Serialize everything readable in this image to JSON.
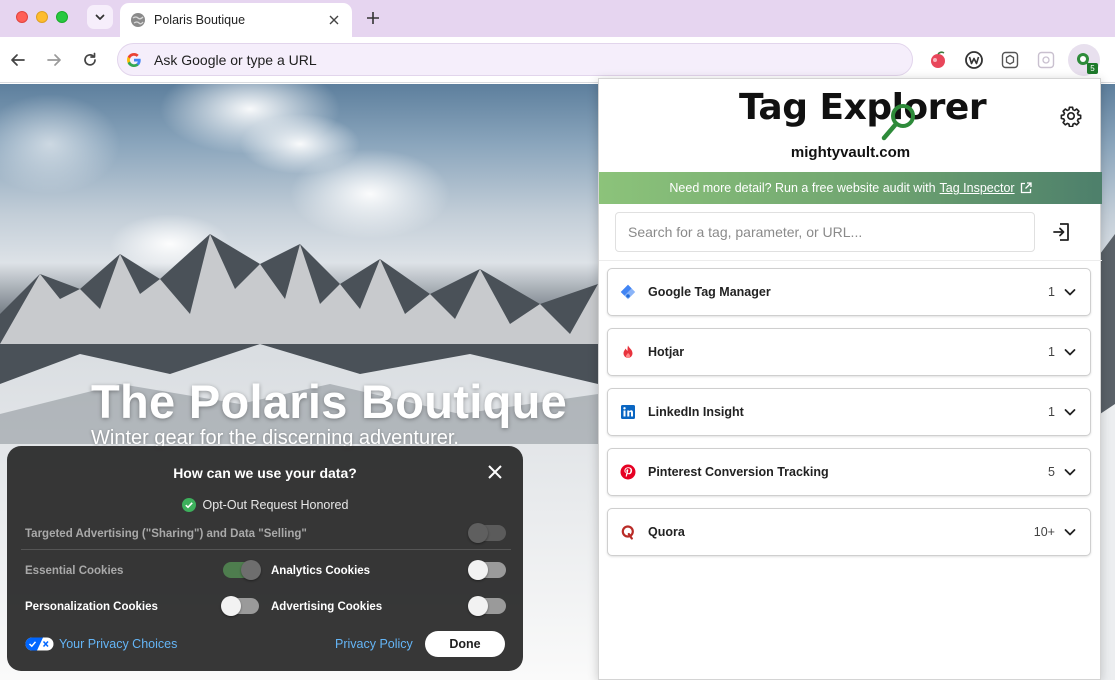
{
  "browser": {
    "tab_title": "Polaris Boutique",
    "omnibox_placeholder": "Ask Google or type a URL",
    "extension_badge": "5",
    "colors": {
      "tabstrip": "#e6d5f0",
      "omnibox": "#f5eefb"
    }
  },
  "page": {
    "hero_title": "The Polaris Boutique",
    "hero_subtitle": "Winter gear for the discerning adventurer."
  },
  "consent": {
    "title": "How can we use your data?",
    "status": "Opt-Out Request Honored",
    "rows": {
      "targeted": "Targeted Advertising (\"Sharing\") and Data \"Selling\"",
      "essential": "Essential Cookies",
      "analytics": "Analytics Cookies",
      "personalization": "Personalization Cookies",
      "advertising": "Advertising Cookies"
    },
    "privacy_choices": "Your Privacy Choices",
    "privacy_policy": "Privacy Policy",
    "done": "Done"
  },
  "popup": {
    "logo": "Tag Explorer",
    "domain": "mightyvault.com",
    "banner_text": "Need more detail? Run a free website audit with",
    "banner_link": "Tag Inspector",
    "search_placeholder": "Search for a tag, parameter, or URL...",
    "tags": [
      {
        "name": "Google Tag Manager",
        "count": "1",
        "icon": "gtm-icon"
      },
      {
        "name": "Hotjar",
        "count": "1",
        "icon": "hotjar-icon"
      },
      {
        "name": "LinkedIn Insight",
        "count": "1",
        "icon": "linkedin-icon"
      },
      {
        "name": "Pinterest Conversion Tracking",
        "count": "5",
        "icon": "pinterest-icon"
      },
      {
        "name": "Quora",
        "count": "10+",
        "icon": "quora-icon"
      }
    ],
    "colors": {
      "banner_start": "#8cc37a",
      "banner_end": "#4d7f6b",
      "lens": "#2e8b3a"
    }
  }
}
